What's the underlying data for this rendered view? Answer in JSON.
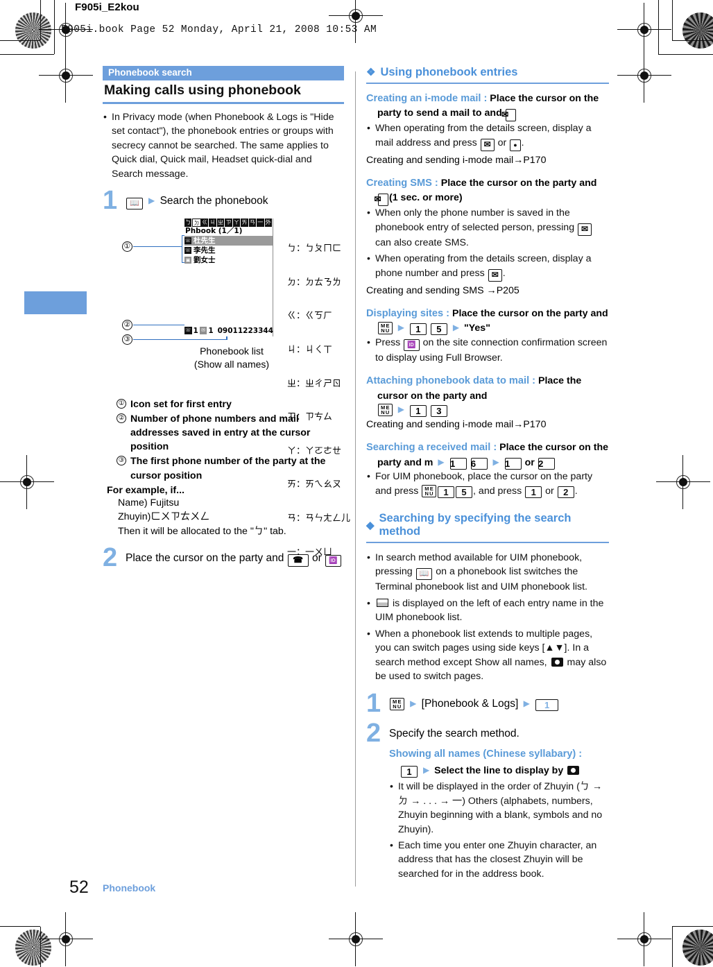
{
  "slug": {
    "title": "F905i_E2kou",
    "book_line": "F905i.book  Page 52  Monday, April 21, 2008  10:53 AM"
  },
  "colors": {
    "accent_blue": "#6d9fdc",
    "heading_blue": "#5a9bd8",
    "step_number_blue": "#7fb0e2",
    "callout_box_blue": "#2f6fbf"
  },
  "left": {
    "section_tag": "Phonebook search",
    "section_title": "Making calls using phonebook",
    "intro_bullets": [
      "In Privacy mode (when Phonebook & Logs is \"Hide set contact\"), the phonebook entries or groups with secrecy cannot be searched. The same applies to Quick dial, Quick mail, Headset quick-dial and Search message."
    ],
    "step1": {
      "number": "1",
      "key_icon": "phonebook-key",
      "arrow": "▶",
      "text": "Search the phonebook"
    },
    "figure": {
      "tabs": [
        "ㄅ",
        "ㄉ",
        "ㄍ",
        "ㄐ",
        "ㄓ",
        "ㄗ",
        "ㄚ",
        "ㄞ",
        "ㄢ",
        "一",
        "外"
      ],
      "selected_tab_index": 1,
      "screen_title": "Phbook (1／1)",
      "entries": [
        {
          "icon": "phone-icon",
          "name": "杜先生",
          "selected": true
        },
        {
          "icon": "phone-icon",
          "name": "李先生",
          "selected": false
        },
        {
          "icon": "mobile-icon",
          "name": "劉女士",
          "selected": false
        }
      ],
      "status_phone_count": "1",
      "status_mail_count": "1",
      "status_number": "09011223344",
      "caption_line1": "Phonebook list",
      "caption_line2": "(Show all names)",
      "callouts": [
        "①",
        "②",
        "③"
      ],
      "zhuyin_rows": [
        "ㄅ：ㄅㄆㄇㄈ",
        "ㄉ：ㄉㄊㄋㄌ",
        "ㄍ：ㄍㄎㄏ",
        "ㄐ：ㄐㄑㄒ",
        "ㄓ：ㄓㄔㄕㄖ",
        "ㄗ：ㄗㄘㄙ",
        "ㄚ：ㄚㄛㄜㄝ",
        "ㄞ：ㄞㄟㄠㄡ",
        "ㄢ：ㄢㄣㄤㄥ儿",
        "一：一ㄨㄩ"
      ]
    },
    "callout_items": [
      {
        "num": "①",
        "text": "Icon set for first entry"
      },
      {
        "num": "②",
        "text": "Number of phone numbers and mail addresses saved in entry at the cursor position"
      },
      {
        "num": "③",
        "text": "The first phone number of the party at the cursor position"
      }
    ],
    "example": {
      "heading": "For example, if...",
      "name_line": "Name) Fujitsu",
      "zhuyin_label": "Zhuyin)",
      "zhuyin_value": "ㄈㄨㄗㄊㄨㄥ",
      "result_pre": "Then it will be allocated to the \"",
      "result_char": "ㄅ",
      "result_post": "\" tab."
    },
    "step2": {
      "number": "2",
      "text_before": "Place the cursor on the party and",
      "key_a": "call-key",
      "or": "or",
      "key_b": "imode-key"
    }
  },
  "right": {
    "section1": {
      "glyph": "❖",
      "title": "Using phonebook entries",
      "blocks": [
        {
          "lead": "Creating an i-mode mail :",
          "bold_text": "Place the cursor on the party to send a mail to and",
          "bold_key": "mail-key",
          "bullets": [
            {
              "pre": "When operating from the details screen, display a mail address and press",
              "key1": "mail-key",
              "mid": "or",
              "key2": "select-key",
              "post": "."
            }
          ],
          "ref": "Creating and sending i-mode mail→P170"
        },
        {
          "lead": "Creating SMS :",
          "bold_text": "Place the cursor on the party and",
          "bold_key": "mail-key",
          "bold_suffix": "(1 sec. or more)",
          "bullets": [
            {
              "pre": "When only the phone number is saved in the phonebook entry of selected person, pressing",
              "key1": "mail-key",
              "post": "can also create SMS."
            },
            {
              "pre": "When operating from the details screen, display a phone number and press",
              "key1": "mail-key",
              "post": "."
            }
          ],
          "ref": "Creating and sending SMS →P205"
        },
        {
          "lead": "Displaying sites :",
          "bold_text": "Place the cursor on the party and",
          "keys": [
            "menu-key",
            "▶",
            "1",
            "5",
            "▶"
          ],
          "quote": "\"Yes\"",
          "bullets": [
            {
              "pre": "Press",
              "key1": "imode-key",
              "post": "on the site connection confirmation screen to display using Full Browser."
            }
          ]
        },
        {
          "lead": "Attaching phonebook data to mail :",
          "bold_text": "Place the cursor on the party and",
          "keys": [
            "menu-key",
            "▶",
            "1",
            "3"
          ],
          "ref": "Creating and sending i-mode mail→P170"
        },
        {
          "lead": "Searching a received mail :",
          "bold_text": "Place the cursor on the party and m",
          "keys": [
            "▶",
            "1",
            "6",
            "▶",
            "1",
            "or",
            "2"
          ],
          "bullets": [
            {
              "pre": "For UIM phonebook, place the cursor on the party and press",
              "keys": [
                "menu-key",
                "1",
                "5"
              ],
              "mid": ", and press",
              "keys2": [
                "1",
                "or",
                "2"
              ],
              "post": "."
            }
          ]
        }
      ]
    },
    "section2": {
      "glyph": "◆",
      "title": "Searching by specifying the search method",
      "bullets": [
        {
          "pre": "In search method available for UIM phonebook, pressing",
          "key1": "phonebook-key",
          "post": "on a phonebook list switches the Terminal phonebook list and UIM phonebook list."
        },
        {
          "pre": "",
          "key1": "uim-icon",
          "post": "is displayed on the left of each entry name in the UIM phonebook list."
        },
        {
          "pre": "When a phonebook list extends to multiple pages, you can switch pages using side keys [▲▼]. In a search method except Show all names,",
          "key1": "nav-key",
          "post": "may also be used to switch pages."
        }
      ],
      "step1": {
        "number": "1",
        "key": "menu-key",
        "arrow1": "▶",
        "menu_label": "[Phonebook & Logs]",
        "arrow2": "▶",
        "key_num": "1"
      },
      "step2": {
        "number": "2",
        "text": "Specify the search method.",
        "sub_lead": "Showing all names (Chinese syllabary) :",
        "sub_key": "1",
        "sub_arrow": "▶",
        "sub_text": "Select the line to display by",
        "sub_key2": "nav-key",
        "bullets": [
          "It will be displayed in the order of Zhuyin (ㄅ → ㄉ → . . . → 一) Others (alphabets, numbers, Zhuyin beginning with a blank, symbols and no Zhuyin).",
          "Each time you enter one Zhuyin character, an address that has the closest Zhuyin will be searched for in the address book."
        ]
      }
    }
  },
  "footer": {
    "page_number": "52",
    "section_label": "Phonebook"
  }
}
